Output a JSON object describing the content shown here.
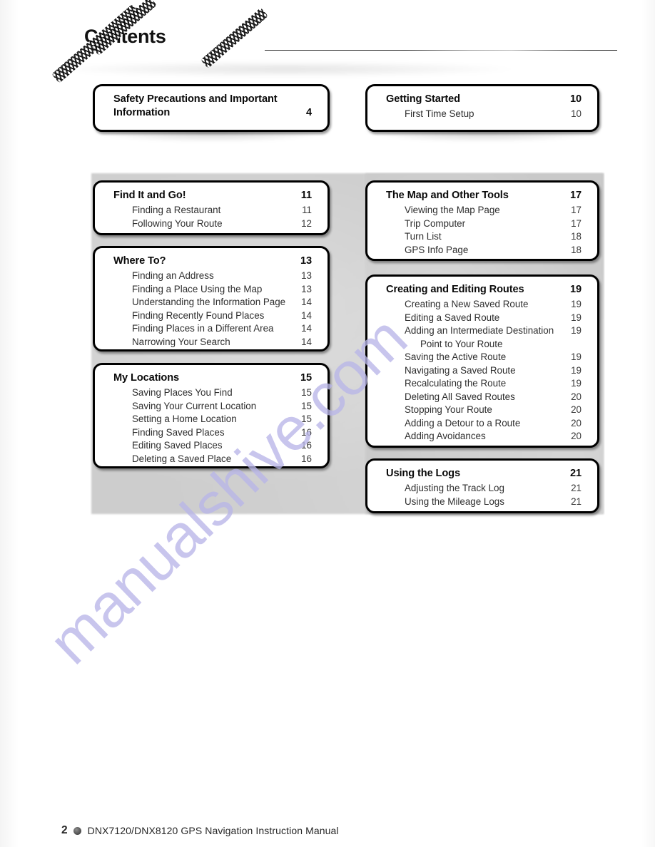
{
  "page": {
    "title": "Contents",
    "watermark": "manualshive.com"
  },
  "footer": {
    "page_number": "2",
    "text": "DNX7120/DNX8120 GPS Navigation Instruction Manual",
    "bullet_icon": "dot-icon"
  },
  "sections": {
    "safety": {
      "title": "Safety Precautions and Important Information",
      "page": "4",
      "entries": []
    },
    "getting_started": {
      "title": "Getting Started",
      "page": "10",
      "entries": [
        {
          "title": "First Time Setup",
          "page": "10"
        }
      ]
    },
    "find_it_and_go": {
      "title": "Find It and Go!",
      "page": "11",
      "entries": [
        {
          "title": "Finding a Restaurant",
          "page": "11"
        },
        {
          "title": "Following Your Route",
          "page": "12"
        }
      ]
    },
    "where_to": {
      "title": "Where To?",
      "page": "13",
      "entries": [
        {
          "title": "Finding an Address",
          "page": "13"
        },
        {
          "title": "Finding a Place Using the Map",
          "page": "13"
        },
        {
          "title": "Understanding the Information Page",
          "page": "14"
        },
        {
          "title": "Finding Recently Found Places",
          "page": "14"
        },
        {
          "title": "Finding Places in a Different Area",
          "page": "14"
        },
        {
          "title": "Narrowing Your Search",
          "page": "14"
        }
      ]
    },
    "my_locations": {
      "title": "My Locations",
      "page": "15",
      "entries": [
        {
          "title": "Saving Places You Find",
          "page": "15"
        },
        {
          "title": "Saving Your Current Location",
          "page": "15"
        },
        {
          "title": "Setting a Home Location",
          "page": "15"
        },
        {
          "title": "Finding Saved Places",
          "page": "16"
        },
        {
          "title": "Editing Saved Places",
          "page": "16"
        },
        {
          "title": "Deleting a Saved Place",
          "page": "16"
        }
      ]
    },
    "map_and_tools": {
      "title": "The Map and Other Tools",
      "page": "17",
      "entries": [
        {
          "title": "Viewing the Map Page",
          "page": "17"
        },
        {
          "title": "Trip Computer",
          "page": "17"
        },
        {
          "title": "Turn List",
          "page": "18"
        },
        {
          "title": "GPS Info Page",
          "page": "18"
        }
      ]
    },
    "routes": {
      "title": "Creating and Editing Routes",
      "page": "19",
      "entries": [
        {
          "title": "Creating a New Saved Route",
          "page": "19"
        },
        {
          "title": "Editing a Saved Route",
          "page": "19"
        },
        {
          "title": "Adding an Intermediate Destination",
          "continuation": "Point to Your Route",
          "page": "19"
        },
        {
          "title": "Saving the Active Route",
          "page": "19"
        },
        {
          "title": "Navigating a Saved Route",
          "page": "19"
        },
        {
          "title": "Recalculating the Route",
          "page": "19"
        },
        {
          "title": "Deleting All Saved Routes",
          "page": "20"
        },
        {
          "title": "Stopping Your Route",
          "page": "20"
        },
        {
          "title": "Adding a Detour to a Route",
          "page": "20"
        },
        {
          "title": "Adding Avoidances",
          "page": "20"
        }
      ]
    },
    "logs": {
      "title": "Using the Logs",
      "page": "21",
      "entries": [
        {
          "title": "Adjusting the Track Log",
          "page": "21"
        },
        {
          "title": "Using the Mileage Logs",
          "page": "21"
        }
      ]
    }
  }
}
